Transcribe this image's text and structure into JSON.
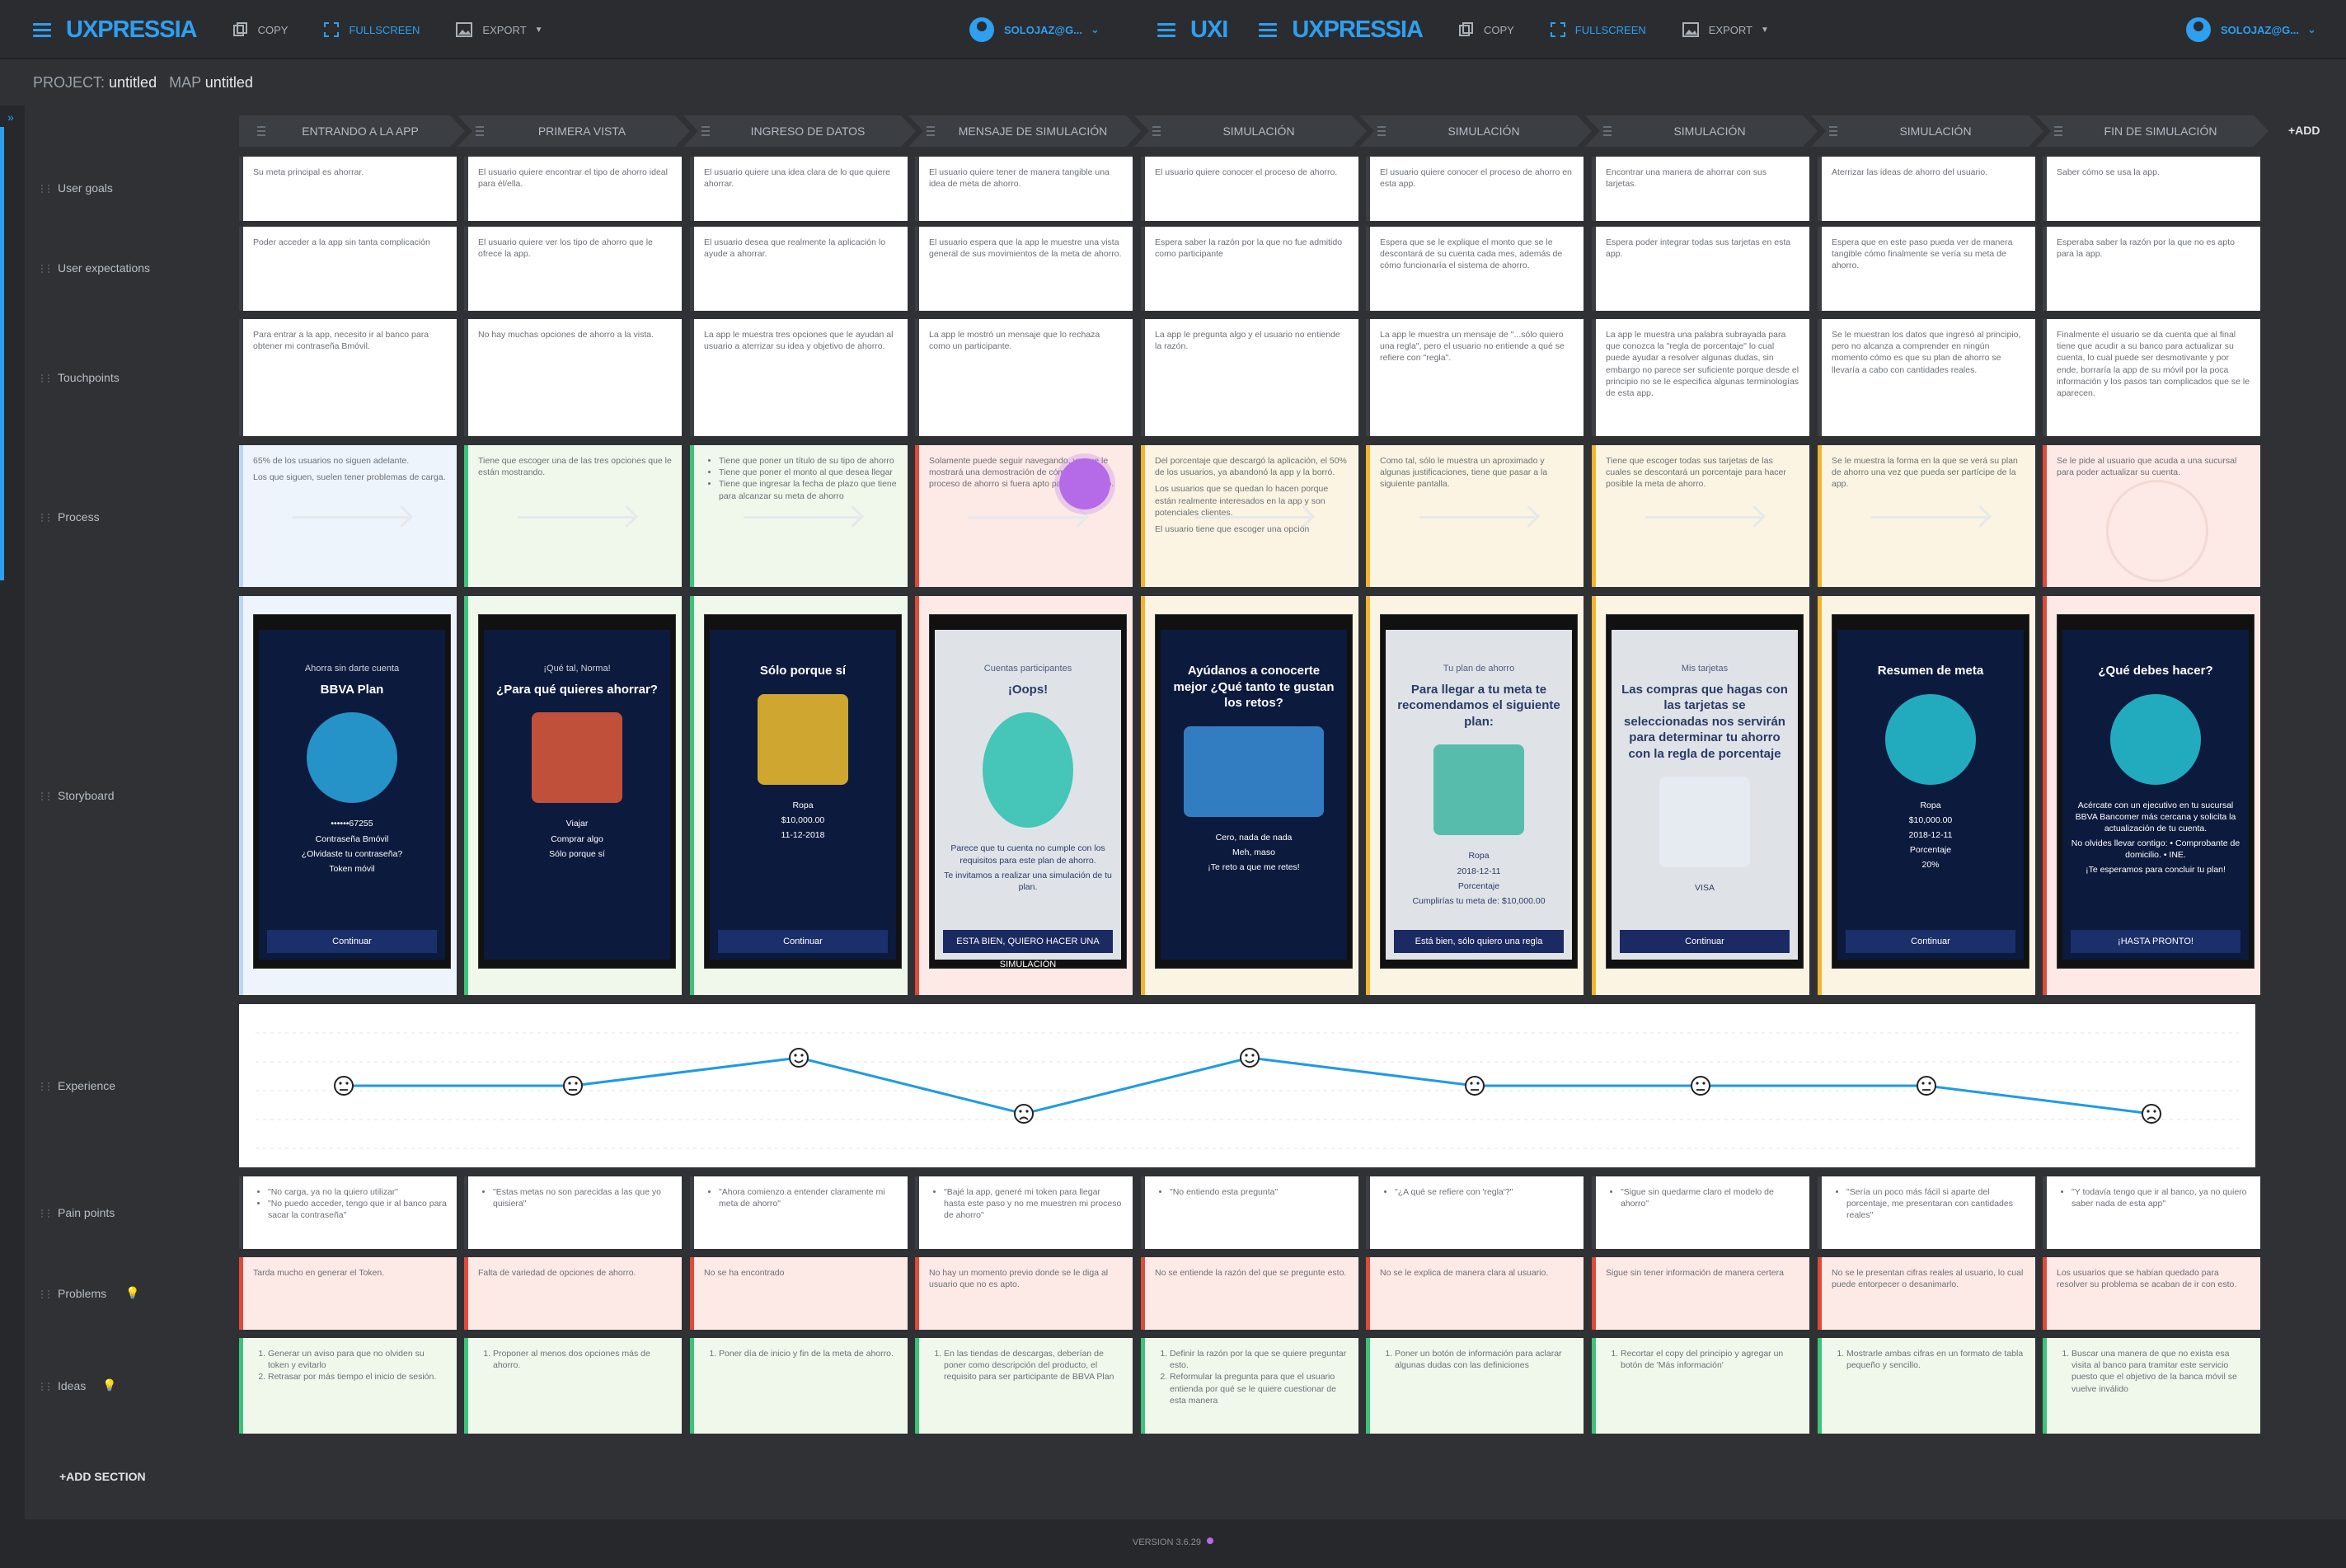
{
  "app": {
    "logo": "UXPRESSIA",
    "logo_partial": "UXI",
    "toolbar": {
      "copy": "COPY",
      "fullscreen": "FULLSCREEN",
      "export": "EXPORT"
    },
    "user": "SOLOJAZ@G..."
  },
  "project": {
    "project_label": "PROJECT:",
    "project_name": "untitled",
    "map_label": "MAP",
    "map_name": "untitled"
  },
  "columns": [
    "ENTRANDO A LA APP",
    "PRIMERA VISTA",
    "INGRESO DE DATOS",
    "MENSAJE DE SIMULACIÓN",
    "SIMULACIÓN",
    "SIMULACIÓN",
    "SIMULACIÓN",
    "SIMULACIÓN",
    "FIN DE SIMULACIÓN"
  ],
  "add_column": "+ADD",
  "rows": {
    "user_goals": "User goals",
    "user_expectations": "User expectations",
    "touchpoints": "Touchpoints",
    "process": "Process",
    "storyboard": "Storyboard",
    "experience": "Experience",
    "pain_points": "Pain points",
    "problems": "Problems",
    "ideas": "Ideas"
  },
  "user_goals": [
    "Su meta principal es ahorrar.",
    "El usuario quiere encontrar el tipo de ahorro ideal para él/ella.",
    "El usuario quiere una idea clara de lo que quiere ahorrar.",
    "El usuario quiere tener de manera tangible una idea de meta de ahorro.",
    "El usuario quiere conocer el proceso de ahorro.",
    "El usuario quiere conocer el proceso de ahorro en esta app.",
    "Encontrar una manera de ahorrar con sus tarjetas.",
    "Aterrizar las ideas de ahorro del usuario.",
    "Saber cómo se usa la app."
  ],
  "user_expectations": [
    "Poder acceder a la app sin tanta complicación",
    "El usuario quiere ver los tipo de ahorro que le ofrece la app.",
    "El usuario desea que realmente la aplicación lo ayude a ahorrar.",
    "El usuario espera que la app le muestre una vista general de sus movimientos de la meta de ahorro.",
    "Espera saber la razón por la que no fue admitido como participante",
    "Espera que se le explique el monto que se le descontará de su cuenta cada mes, además de cómo funcionaría el sistema de ahorro.",
    "Espera poder integrar todas sus tarjetas en esta app.",
    "Espera que en este paso pueda ver de manera tangible cómo finalmente se vería su meta de ahorro.",
    "Esperaba saber la razón por la que no es apto para la app."
  ],
  "touchpoints": [
    "Para entrar a la app, necesito ir al banco para obtener mi contraseña Bmóvil.",
    "No hay muchas opciones de ahorro a la vista.",
    "La app le muestra tres opciones que le ayudan al usuario a aterrizar su idea y objetivo de ahorro.",
    "La app le mostró un mensaje que lo rechaza como un participante.",
    "La app le pregunta algo y el usuario no entiende la razón.",
    "La app le muestra un mensaje de \"...sólo quiero una regla\", pero el usuario no entiende a qué se refiere con \"regla\".",
    "La app le muestra una palabra subrayada para que conozca la \"regla de porcentaje\" lo cual puede ayudar a resolver algunas dudas, sin embargo no parece ser suficiente porque desde el principio no se le especifica algunas terminologías de esta app.",
    "Se le muestran los datos que ingresó al principio, pero no alcanza a comprender en ningún momento cómo es que su plan de ahorro se llevaría a cabo con cantidades reales.",
    "Finalmente el usuario se da cuenta que al final tiene que acudir a su banco para actualizar su cuenta, lo cual puede ser desmotivante y por ende, borraría la app de su móvil por la poca información y los pasos tan complicados que se le aparecen."
  ],
  "process": [
    {
      "color": "blue",
      "lines": [
        "65% de los usuarios no siguen adelante.",
        "Los que siguen, suelen tener problemas de carga."
      ]
    },
    {
      "color": "green",
      "lines": [
        "Tiene que escoger una de las tres opciones que le están mostrando."
      ]
    },
    {
      "color": "green",
      "bullets": [
        "Tiene que poner un título de su tipo de ahorro",
        "Tiene que poner el monto al que desea llegar",
        "Tiene que ingresar la fecha de plazo que tiene para alcanzar su meta de ahorro"
      ]
    },
    {
      "color": "red",
      "lines": [
        "Solamente puede seguir navegando, ya que le mostrará una demostración de cómo sería su proceso de ahorro si fuera apto para el proceso."
      ]
    },
    {
      "color": "yellow",
      "lines": [
        "Del porcentaje que descargó la aplicación, el 50% de los usuarios, ya abandonó la app y la borró.",
        "Los usuarios que se quedan lo hacen porque están realmente interesados en la app y son potenciales clientes.",
        "El usuario tiene que escoger una opción"
      ]
    },
    {
      "color": "yellow",
      "lines": [
        "Como tal, sólo le muestra un aproximado y algunas justificaciones, tiene que pasar a la siguiente pantalla."
      ]
    },
    {
      "color": "yellow",
      "lines": [
        "Tiene que escoger todas sus tarjetas de las cuales se descontará un porcentaje para hacer posible la meta de ahorro."
      ]
    },
    {
      "color": "yellow",
      "lines": [
        "Se le muestra la forma en la que se verá su plan de ahorro una vez que pueda ser partícipe de la app."
      ]
    },
    {
      "color": "red",
      "lines": [
        "Se le pide al usuario que acuda a una sucursal para poder actualizar su cuenta."
      ]
    }
  ],
  "storyboard": [
    {
      "color": "blue",
      "title": "BBVA Plan",
      "subtitle": "Ahorra sin darte cuenta",
      "extra": "••••••67255",
      "extra2": "Contraseña Bmóvil",
      "extra3": "¿Olvidaste tu contraseña?",
      "extra4": "Token móvil",
      "bottom": "Continuar"
    },
    {
      "color": "green",
      "title": "¿Para qué quieres ahorrar?",
      "subtitle": "¡Qué tal, Norma!",
      "extra": "Viajar",
      "extra2": "Comprar algo",
      "extra3": "Sólo porque sí"
    },
    {
      "color": "green",
      "title": "Sólo porque sí",
      "extra": "Ropa",
      "extra2": "$10,000.00",
      "extra3": "11-12-2018",
      "bottom": "Continuar"
    },
    {
      "color": "red",
      "title": "¡Oops!",
      "subtitle": "Cuentas participantes",
      "extra": "Parece que tu cuenta no cumple con los requisitos para este plan de ahorro.",
      "extra2": "Te invitamos a realizar una simulación de tu plan.",
      "bottom": "ESTA BIEN, QUIERO HACER UNA SIMULACIÓN"
    },
    {
      "color": "yellow",
      "title": "Ayúdanos a conocerte mejor ¿Qué tanto te gustan los retos?",
      "extra": "Cero, nada de nada",
      "extra2": "Meh, maso",
      "extra3": "¡Te reto a que me retes!"
    },
    {
      "color": "yellow",
      "title": "Para llegar a tu meta te recomendamos el siguiente plan:",
      "subtitle": "Tu plan de ahorro",
      "extra": "Ropa",
      "extra2": "2018-12-11",
      "extra3": "Porcentaje",
      "extra4": "Cumplirías tu meta de: $10,000.00",
      "bottom": "Está bien, sólo quiero una regla"
    },
    {
      "color": "yellow",
      "title": "Las compras que hagas con las tarjetas se seleccionadas nos servirán para determinar tu ahorro con la regla de porcentaje",
      "subtitle": "Mis tarjetas",
      "extra": "VISA",
      "bottom": "Continuar"
    },
    {
      "color": "yellow",
      "title": "Resumen de meta",
      "extra": "Ropa",
      "extra2": "$10,000.00",
      "extra3": "2018-12-11",
      "extra4": "Porcentaje",
      "extra5": "20%",
      "bottom": "Continuar"
    },
    {
      "color": "red",
      "title": "¿Qué debes hacer?",
      "extra": "Acércate con un ejecutivo en tu sucursal BBVA Bancomer más cercana y solicita la actualización de tu cuenta.",
      "extra2": "No olvides llevar contigo: • Comprobante de domicilio. • INE.",
      "extra3": "¡Te esperamos para concluir tu plan!",
      "bottom": "¡HASTA PRONTO!"
    }
  ],
  "experience": {
    "levels": [
      0,
      0,
      1,
      -1,
      1,
      0,
      0,
      0,
      -1
    ],
    "faces": [
      "neutral",
      "neutral",
      "happy",
      "sad",
      "happy",
      "neutral",
      "neutral",
      "neutral",
      "sad"
    ],
    "line_color": "#1f9be0"
  },
  "pain_points": [
    [
      "\"No carga, ya no la quiero utilizar\"",
      "\"No puedo acceder, tengo que ir al banco para sacar la contraseña\""
    ],
    [
      "\"Estas metas no son parecidas a las que yo quisiera\""
    ],
    [
      "\"Ahora comienzo a entender claramente mi meta de ahorro\""
    ],
    [
      "\"Bajé la app, generé mi token para llegar hasta este paso y no me muestren mi proceso de ahorro\""
    ],
    [
      "\"No entiendo esta pregunta\""
    ],
    [
      "\"¿A qué se refiere con 'regla'?\""
    ],
    [
      "\"Sigue sin quedarme claro el modelo de ahorro\""
    ],
    [
      "\"Sería un poco más fácil si aparte del porcentaje, me presentaran con cantidades reales\""
    ],
    [
      "\"Y todavía tengo que ir al banco, ya no quiero saber nada de esta app\""
    ]
  ],
  "problems": [
    "Tarda mucho en generar el Token.",
    "Falta de variedad de opciones de ahorro.",
    "No se ha encontrado",
    "No hay un momento previo donde se le diga al usuario que no es apto.",
    "No se entiende la razón del que se pregunte esto.",
    "No se le explica de manera clara al usuario.",
    "Sigue sin tener información de manera certera",
    "No se le presentan cifras reales al usuario, lo cual puede entorpecer o desanimarlo.",
    "Los usuarios que se habían quedado para resolver su problema se acaban de ir con esto."
  ],
  "ideas": [
    [
      "Generar un aviso para que no olviden su token y evitarlo",
      "Retrasar por más tiempo el inicio de sesión."
    ],
    [
      "Proponer al menos dos opciones más de ahorro."
    ],
    [
      "Poner día de inicio y fin de la meta de ahorro."
    ],
    [
      "En las tiendas de descargas, deberían de poner como descripción del producto, el requisito para ser participante de BBVA Plan"
    ],
    [
      "Definir la razón por la que se quiere preguntar esto.",
      "Reformular la pregunta para que el usuario entienda por qué se le quiere cuestionar de esta manera"
    ],
    [
      "Poner un botón de información para aclarar algunas dudas con las definiciones"
    ],
    [
      "Recortar el copy del principio y agregar un botón de 'Más información'"
    ],
    [
      "Mostrarle ambas cifras en un formato de tabla pequeño y sencillo."
    ],
    [
      "Buscar una manera de que no exista esa visita al banco para tramitar este servicio puesto que el objetivo de la banca móvil se vuelve inválido"
    ]
  ],
  "add_section": "+ADD SECTION",
  "version": "VERSION 3.6.29"
}
